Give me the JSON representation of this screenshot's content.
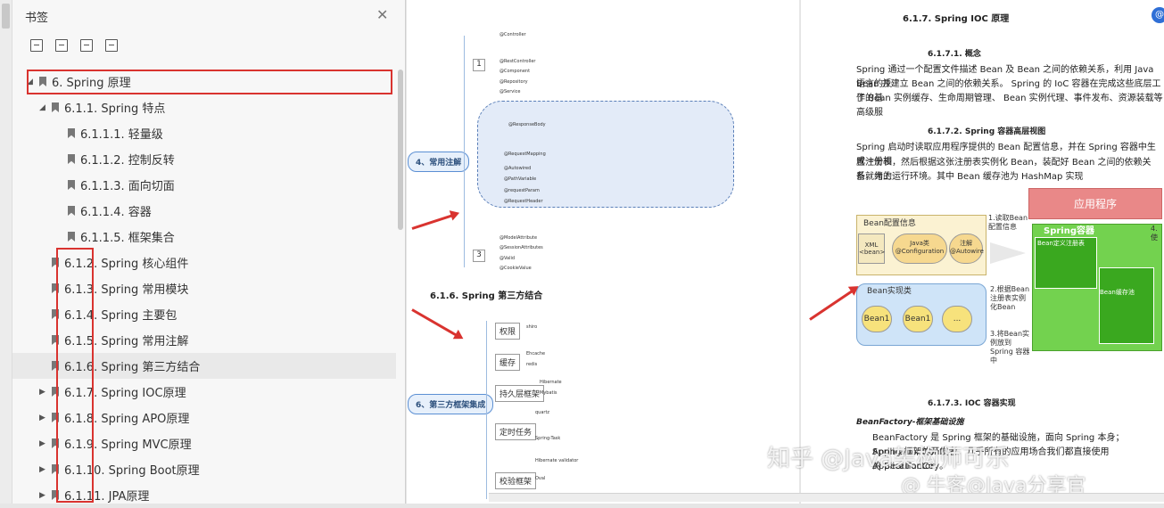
{
  "sidebar": {
    "title": "书签",
    "items": [
      {
        "label": "6. Spring 原理",
        "level": 0
      },
      {
        "label": "6.1.1. Spring 特点",
        "level": 1
      },
      {
        "label": "6.1.1.1. 轻量级",
        "level": 2
      },
      {
        "label": "6.1.1.2. 控制反转",
        "level": 2
      },
      {
        "label": "6.1.1.3. 面向切面",
        "level": 2
      },
      {
        "label": "6.1.1.4. 容器",
        "level": 2
      },
      {
        "label": "6.1.1.5. 框架集合",
        "level": 2
      },
      {
        "label": "6.1.2. Spring 核心组件",
        "level": 1
      },
      {
        "label": "6.1.3. Spring 常用模块",
        "level": 1
      },
      {
        "label": "6.1.4. Spring 主要包",
        "level": 1
      },
      {
        "label": "6.1.5. Spring 常用注解",
        "level": 1
      },
      {
        "label": "6.1.6. Spring 第三方结合",
        "level": 1
      },
      {
        "label": "6.1.7. Spring IOC原理",
        "level": 1
      },
      {
        "label": "6.1.8. Spring APO原理",
        "level": 1
      },
      {
        "label": "6.1.9. Spring MVC原理",
        "level": 1
      },
      {
        "label": "6.1.10. Spring Boot原理",
        "level": 1
      },
      {
        "label": "6.1.11. JPA原理",
        "level": 1
      }
    ]
  },
  "page1": {
    "mindmap1_root": "4、常用注解",
    "mindmap1_items": [
      "@Controller",
      "@RestController",
      "@Component",
      "@Repository",
      "@Service",
      "@ResponseBody",
      "@RequestMapping",
      "@Autowired",
      "@PathVariable",
      "@requestParam",
      "@RequestHeader",
      "@ModelAttribute",
      "@SessionAttributes",
      "@Valid",
      "@CookieValue"
    ],
    "section_title": "6.1.6. Spring 第三方结合",
    "mindmap2_root": "6、第三方框架集成",
    "mindmap2_items": [
      "权限",
      "缓存",
      "持久层框架",
      "定时任务",
      "校验框架"
    ],
    "mindmap2_sub": [
      "shiro",
      "Ehcache",
      "redis",
      "Hibernate",
      "Mybatis",
      "quartz",
      "Spring-Task",
      "Hibernate validator",
      "Oval"
    ]
  },
  "page2": {
    "h1": "6.1.7. Spring IOC 原理",
    "h2": "6.1.7.1.      概念",
    "p1": "Spring 通过一个配置文件描述 Bean 及 Bean 之间的依赖关系，利用 Java 语言的反",
    "p2": "Bean 并建立 Bean 之间的依赖关系。 Spring 的 IoC 容器在完成这些底层工作的基",
    "p3": "了 Bean 实例缓存、生命周期管理、 Bean 实例代理、事件发布、资源装载等高级服",
    "h3": "6.1.7.2.      Spring 容器高层视图",
    "p4": "Spring 启动时读取应用程序提供的 Bean 配置信息，并在 Spring 容器中生成一份相",
    "p5": "置注册表，然后根据这张注册表实例化 Bean，装配好 Bean 之间的依赖关系，为上",
    "p6": "备就绪的运行环境。其中 Bean 缓存池为 HashMap 实现",
    "diagram": {
      "app": "应用程序",
      "bean_config": "Bean配置信息",
      "xml": "XML <bean>",
      "java": "Java类 @Configuration",
      "anno": "注解 @Autowire",
      "read": "1.读取Bean 配置信息",
      "container": "Spring容器",
      "registry": "Bean定义注册表",
      "impl": "Bean实现类",
      "bean1": "Bean1",
      "bean2": "Bean1",
      "dots": "...",
      "step2": "2.根据Bean 注册表实例 化Bean",
      "step3": "3.将Bean实 例放到Spring 容器中",
      "pool": "Bean缓存池",
      "use": "4.使"
    },
    "h4": "6.1.7.3.      IOC 容器实现",
    "h5": "BeanFactory-框架基础设施",
    "p7": "BeanFactory 是 Spring 框架的基础设施，面向 Spring 本身；ApplicationCont",
    "p8": "Spring 框架的开发者，几乎所有的应用场合我们都直接使用 ApplicationCo",
    "p9": "的 BeanFactory。"
  },
  "watermark": {
    "zhihu": "知乎 @Java架构师可乐",
    "niuke": "@ 牛客@Java分享官"
  }
}
